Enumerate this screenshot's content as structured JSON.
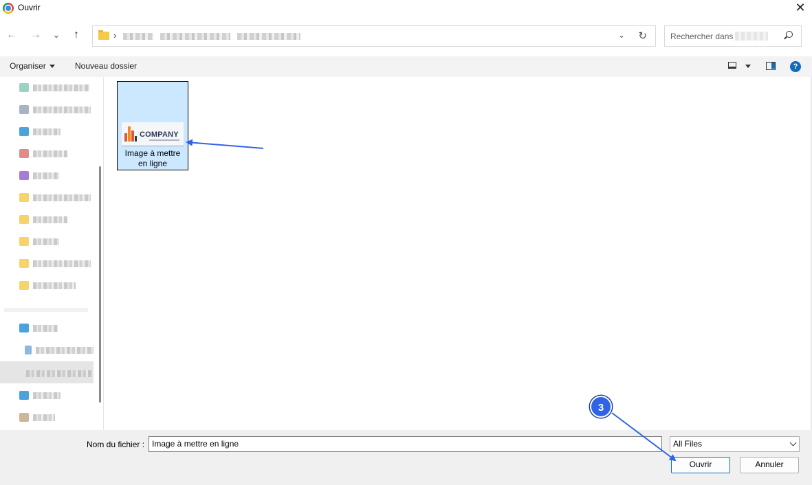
{
  "window": {
    "title": "Ouvrir",
    "close_glyph": "✕",
    "app_icon": "chrome-icon"
  },
  "nav": {
    "back": "←",
    "forward": "→",
    "recent": "⌄",
    "up": "↑",
    "crumb_separator": "›",
    "address_chevron": "⌄",
    "refresh": "↻"
  },
  "search": {
    "placeholder": "Rechercher dans :"
  },
  "toolbar": {
    "organize": "Organiser",
    "new_folder": "Nouveau dossier",
    "help": "?"
  },
  "file": {
    "name_line1": "Image à mettre",
    "name_line2": "en ligne",
    "thumb_text": "COMPANY"
  },
  "bottom": {
    "filename_label": "Nom du fichier :",
    "filename_value": "Image à mettre en ligne",
    "filter_value": "All Files",
    "open_button": "Ouvrir",
    "cancel_button": "Annuler"
  },
  "annotation": {
    "step_number": "3",
    "color": "#2f64e6"
  },
  "colors": {
    "selection": "#cce8ff",
    "accent": "#0f6cbd",
    "toolbar_bg": "#f3f3f3",
    "footer_bg": "#f0f0f0"
  }
}
